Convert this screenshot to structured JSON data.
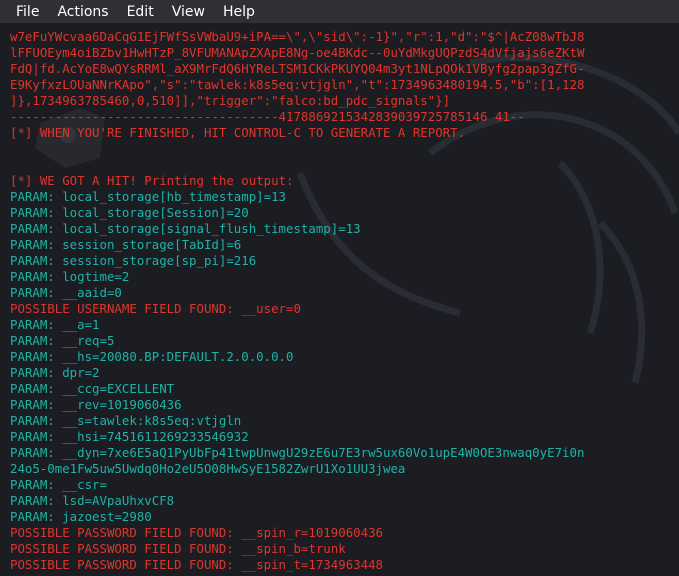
{
  "menu": {
    "items": [
      "File",
      "Actions",
      "Edit",
      "View",
      "Help"
    ]
  },
  "terminal": {
    "lines": [
      {
        "text": "w7eFuYWcvaa6DaCqG1EjFWfSsVWbaU9+iPA==\\\",\\\"sid\\\":-1}\",\"r\":1,\"d\":\"$^|AcZ08wTbJ8",
        "color": "red"
      },
      {
        "text": "lFFUOEym4oiBZbv1HwHTzP_8VFUMANApZXApE8Ng-oe4BKdc--0uYdMkgUQPzdS4dVfjajs6eZKtW",
        "color": "red"
      },
      {
        "text": "FdQ|fd.AcYoE8wQYsRRMl_aX9MrFdQ6HYReLTSM1CKkPKUYQ04m3yt1NLpQOk1VByfg2pap3gZfG-",
        "color": "red"
      },
      {
        "text": "E9KyfxzLOUaNNrKApo\",\"s\":\"tawlek:k8s5eq:vtjgln\",\"t\":1734963480194.5,\"b\":[1,128",
        "color": "red"
      },
      {
        "text": "]},1734963785460,0,510]],\"trigger\":\"falco:bd_pdc_signals\"}]",
        "color": "red"
      },
      {
        "text": "------------------------------------4178869215342839039725785146 41--",
        "color": "sep"
      },
      {
        "text": "[*] WHEN YOU'RE FINISHED, HIT CONTROL-C TO GENERATE A REPORT.",
        "color": "red"
      },
      {
        "text": "",
        "color": "blank"
      },
      {
        "text": "",
        "color": "blank"
      },
      {
        "text": "[*] WE GOT A HIT! Printing the output:",
        "color": "red"
      },
      {
        "text": "PARAM: local_storage[hb_timestamp]=13",
        "color": "cyan"
      },
      {
        "text": "PARAM: local_storage[Session]=20",
        "color": "cyan"
      },
      {
        "text": "PARAM: local_storage[signal_flush_timestamp]=13",
        "color": "cyan"
      },
      {
        "text": "PARAM: session_storage[TabId]=6",
        "color": "cyan"
      },
      {
        "text": "PARAM: session_storage[sp_pi]=216",
        "color": "cyan"
      },
      {
        "text": "PARAM: logtime=2",
        "color": "cyan"
      },
      {
        "text": "PARAM: __aaid=0",
        "color": "cyan"
      },
      {
        "text": "POSSIBLE USERNAME FIELD FOUND: __user=0",
        "color": "red"
      },
      {
        "text": "PARAM: __a=1",
        "color": "cyan"
      },
      {
        "text": "PARAM: __req=5",
        "color": "cyan"
      },
      {
        "text": "PARAM: __hs=20080.BP:DEFAULT.2.0.0.0.0",
        "color": "cyan"
      },
      {
        "text": "PARAM: dpr=2",
        "color": "cyan"
      },
      {
        "text": "PARAM: __ccg=EXCELLENT",
        "color": "cyan"
      },
      {
        "text": "PARAM: __rev=1019060436",
        "color": "cyan"
      },
      {
        "text": "PARAM: __s=tawlek:k8s5eq:vtjgln",
        "color": "cyan"
      },
      {
        "text": "PARAM: __hsi=7451611269233546932",
        "color": "cyan"
      },
      {
        "text": "PARAM: __dyn=7xe6E5aQ1PyUbFp41twpUnwgU29zE6u7E3rw5ux60Vo1upE4W0OE3nwaq0yE7i0n",
        "color": "cyan"
      },
      {
        "text": "24o5-0me1Fw5uw5Uwdq0Ho2eU5O08HwSyE1582ZwrU1Xo1UU3jwea",
        "color": "cyan"
      },
      {
        "text": "PARAM: __csr=",
        "color": "cyan"
      },
      {
        "text": "PARAM: lsd=AVpaUhxvCF8",
        "color": "cyan"
      },
      {
        "text": "PARAM: jazoest=2980",
        "color": "cyan"
      },
      {
        "text": "POSSIBLE PASSWORD FIELD FOUND: __spin_r=1019060436",
        "color": "red"
      },
      {
        "text": "POSSIBLE PASSWORD FIELD FOUND: __spin_b=trunk",
        "color": "red"
      },
      {
        "text": "POSSIBLE PASSWORD FIELD FOUND: __spin_t=1734963448",
        "color": "red"
      }
    ]
  },
  "colors": {
    "background": "#1b1d23",
    "menubar": "#2e3036",
    "red": "#e0352b",
    "cyan": "#1fb3a6"
  }
}
